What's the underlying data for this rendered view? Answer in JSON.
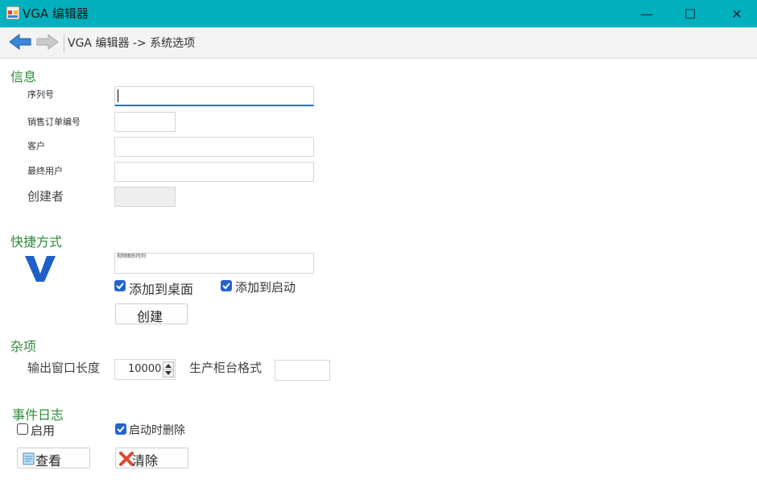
{
  "window": {
    "title": "VGA 编辑器",
    "minimize_glyph": "—",
    "maximize_glyph": "☐",
    "close_glyph": "✕",
    "accent": "#00b0bd"
  },
  "nav": {
    "back_icon": "left-arrow-icon",
    "forward_icon": "right-arrow-icon",
    "breadcrumb": "VGA 编辑器 -> 系统选项"
  },
  "info": {
    "section_title": "信息",
    "serial_label": "序列号",
    "serial_value": "",
    "order_label": "销售订单编号",
    "order_value": "",
    "customer_label": "客户",
    "customer_value": "",
    "enduser_label": "最终用户",
    "enduser_value": "",
    "creator_label": "创建者",
    "creator_value": ""
  },
  "shortcut": {
    "section_title": "快捷方式",
    "logo_icon": "vga-logo-icon",
    "name_value": "视频图形阵列",
    "add_desktop_label": "添加到桌面",
    "add_desktop_checked": true,
    "add_startup_label": "添加到启动",
    "add_startup_checked": true,
    "create_button": "创建"
  },
  "misc": {
    "section_title": "杂项",
    "output_length_label": "输出窗口长度",
    "output_length_value": "10000",
    "format_label": "生产柜台格式",
    "format_value": ""
  },
  "eventlog": {
    "section_title": "事件日志",
    "enable_label": "启用",
    "enable_checked": false,
    "clear_on_start_label": "启动时删除",
    "clear_on_start_checked": true,
    "view_button": "查看",
    "clear_button": "清除"
  },
  "colors": {
    "section_green": "#2e8b3a",
    "checkbox_blue": "#2563c9",
    "focus_blue": "#2d6fb5",
    "logo_blue": "#1f5fc9"
  }
}
